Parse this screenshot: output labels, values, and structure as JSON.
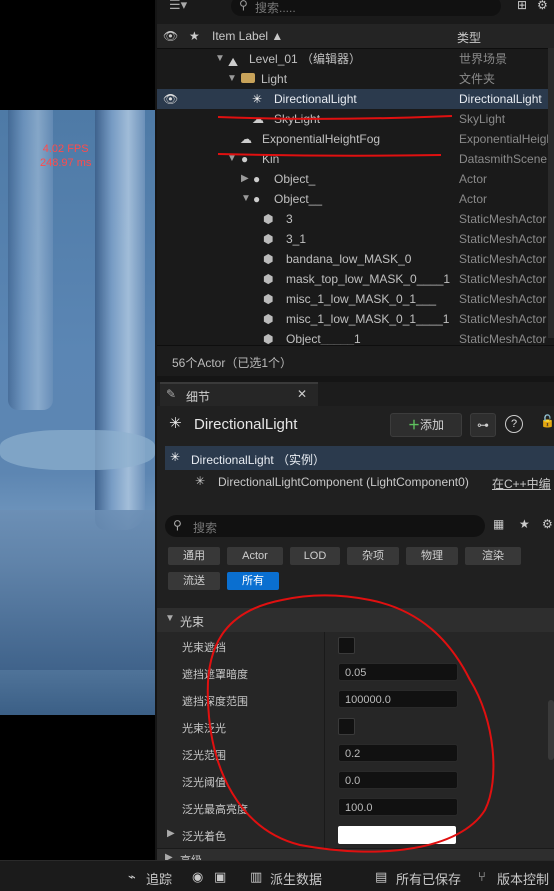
{
  "viewport": {
    "fps": "4.02 FPS",
    "ms": "248.97 ms"
  },
  "outliner": {
    "search_placeholder": "搜索.....",
    "col_label": "Item Label ▲",
    "col_type": "类型",
    "rows": [
      {
        "label": "Level_01 （编辑器）",
        "type": "世界场景"
      },
      {
        "label": "Light",
        "type": "文件夹"
      },
      {
        "label": "DirectionalLight",
        "type": "DirectionalLight"
      },
      {
        "label": "SkyLight",
        "type": "SkyLight"
      },
      {
        "label": "ExponentialHeightFog",
        "type": "ExponentialHeightFog"
      },
      {
        "label": "Kin",
        "type": "DatasmithScene"
      },
      {
        "label": "Object_",
        "type": "Actor"
      },
      {
        "label": "Object__",
        "type": "Actor"
      },
      {
        "label": "3",
        "type": "StaticMeshActor"
      },
      {
        "label": "3_1",
        "type": "StaticMeshActor"
      },
      {
        "label": "bandana_low_MASK_0",
        "type": "StaticMeshActor"
      },
      {
        "label": "mask_top_low_MASK_0____1",
        "type": "StaticMeshActor"
      },
      {
        "label": "misc_1_low_MASK_0_1___",
        "type": "StaticMeshActor"
      },
      {
        "label": "misc_1_low_MASK_0_1____1",
        "type": "StaticMeshActor"
      },
      {
        "label": "Object_____1",
        "type": "StaticMeshActor"
      }
    ],
    "status": "56个Actor（已选1个）"
  },
  "details": {
    "tab_label": "细节",
    "actor_name": "DirectionalLight",
    "add_label": "添加",
    "instance_label": "DirectionalLight （实例）",
    "component_label": "DirectionalLightComponent (LightComponent0)",
    "cpp_link": "在C++中编",
    "search_placeholder": "搜索",
    "filters": [
      "通用",
      "Actor",
      "LOD",
      "杂项",
      "物理",
      "渲染",
      "流送",
      "所有"
    ],
    "section": "光束",
    "props": [
      {
        "label": "光束遮挡",
        "kind": "checkbox",
        "value": ""
      },
      {
        "label": "遮挡遮罩暗度",
        "kind": "number",
        "value": "0.05"
      },
      {
        "label": "遮挡深度范围",
        "kind": "number",
        "value": "100000.0"
      },
      {
        "label": "光束泛光",
        "kind": "checkbox",
        "value": ""
      },
      {
        "label": "泛光范围",
        "kind": "number",
        "value": "0.2"
      },
      {
        "label": "泛光阈值",
        "kind": "number",
        "value": "0.0"
      },
      {
        "label": "泛光最高亮度",
        "kind": "number",
        "value": "100.0"
      },
      {
        "label": "泛光着色",
        "kind": "color",
        "value": ""
      }
    ],
    "next_section": "高级"
  },
  "bottombar": {
    "trace": "追踪",
    "derived": "派生数据",
    "saved": "所有已保存",
    "vcs": "版本控制"
  },
  "colors": {
    "accent": "#0a6fd0",
    "selection": "#2b3a4d",
    "annotation": "#e01010"
  }
}
